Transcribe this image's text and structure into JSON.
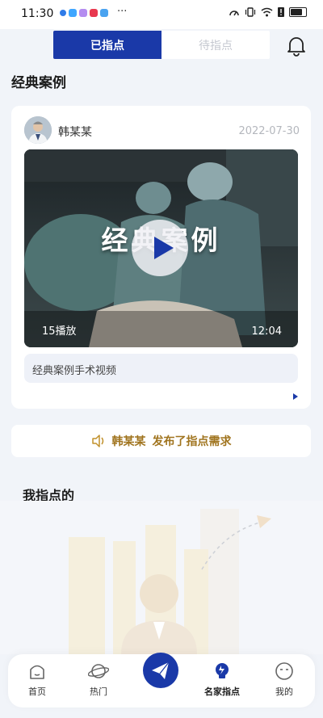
{
  "status_bar": {
    "time": "11:30",
    "dots": "···",
    "app_colors": [
      "#2f7be8",
      "#3fa6ff",
      "#ef6c6c",
      "#e8384f",
      "#4aa3f0"
    ]
  },
  "tabs": [
    {
      "label": "已指点",
      "active": true
    },
    {
      "label": "待指点",
      "active": false
    }
  ],
  "section_title": "经典案例",
  "case_card": {
    "author": "韩某某",
    "date": "2022-07-30",
    "video_overlay_text": "经典案例",
    "play_count": "15播放",
    "duration": "12:04",
    "caption": "经典案例手术视频"
  },
  "notice": {
    "name": "韩某某",
    "message": "发布了指点需求"
  },
  "my_section_title": "我指点的",
  "bottom_nav": [
    {
      "label": "首页",
      "icon": "home-icon"
    },
    {
      "label": "热门",
      "icon": "planet-icon"
    },
    {
      "label": "",
      "icon": "paper-plane-icon"
    },
    {
      "label": "名家指点",
      "icon": "lightbulb-icon",
      "active": true
    },
    {
      "label": "我的",
      "icon": "face-icon"
    }
  ],
  "colors": {
    "primary": "#1a39a8",
    "notice": "#a0741e",
    "background": "#f1f4f9"
  }
}
